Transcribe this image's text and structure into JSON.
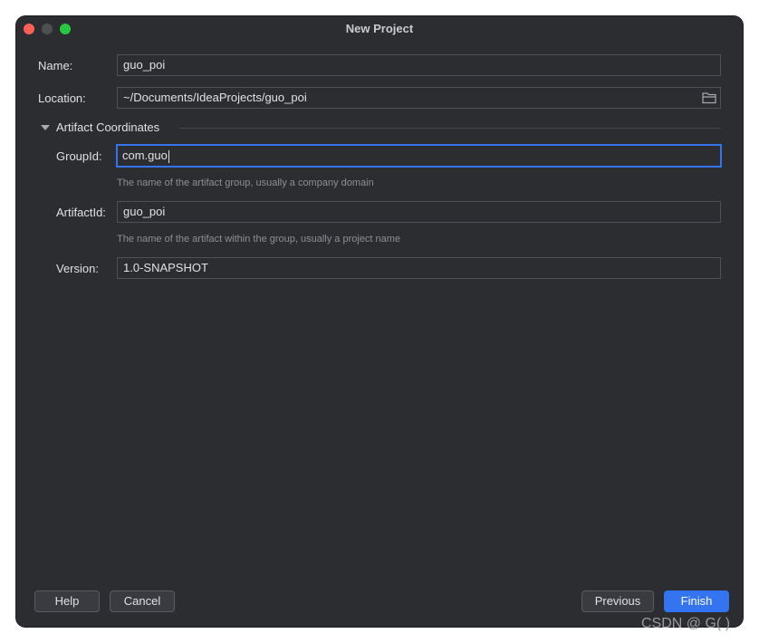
{
  "window": {
    "title": "New Project"
  },
  "form": {
    "name": {
      "label": "Name:",
      "value": "guo_poi"
    },
    "location": {
      "label": "Location:",
      "value": "~/Documents/IdeaProjects/guo_poi"
    },
    "artifact_section": {
      "title": "Artifact Coordinates"
    },
    "group_id": {
      "label": "GroupId:",
      "value": "com.guo",
      "hint": "The name of the artifact group, usually a company domain"
    },
    "artifact_id": {
      "label": "ArtifactId:",
      "value": "guo_poi",
      "hint": "The name of the artifact within the group, usually a project name"
    },
    "version": {
      "label": "Version:",
      "value": "1.0-SNAPSHOT"
    }
  },
  "footer": {
    "help_label": "Help",
    "cancel_label": "Cancel",
    "previous_label": "Previous",
    "finish_label": "Finish"
  },
  "watermark": "CSDN @ G( )",
  "colors": {
    "accent": "#3574f0",
    "background": "#2b2d30",
    "close": "#ff5f57",
    "maximize": "#28c840"
  },
  "icons": {
    "browse": "folder-icon",
    "section_toggle": "triangle-down-icon"
  }
}
